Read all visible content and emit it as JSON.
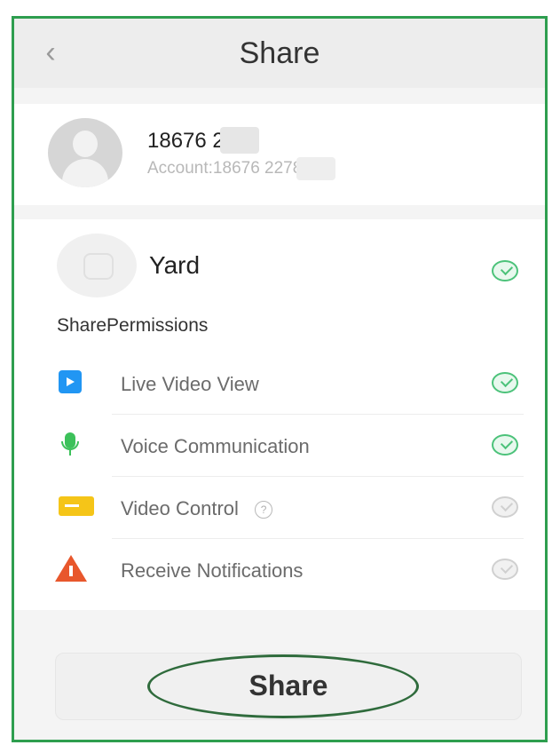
{
  "header": {
    "title": "Share",
    "back_icon": "chevron-left-icon"
  },
  "account": {
    "name": "18676 2278",
    "subtitle": "Account:18676 2278"
  },
  "device": {
    "name": "Yard",
    "selected": true
  },
  "permissions": {
    "heading": "SharePermissions",
    "items": [
      {
        "label": "Live Video View",
        "icon": "video-file-icon",
        "checked": true
      },
      {
        "label": "Voice Communication",
        "icon": "microphone-icon",
        "checked": true
      },
      {
        "label": "Video Control",
        "icon": "camera-icon",
        "checked": false,
        "help": "?"
      },
      {
        "label": "Receive Notifications",
        "icon": "warning-icon",
        "checked": false
      }
    ]
  },
  "share_button": {
    "label": "Share"
  },
  "colors": {
    "frame": "#2e9e4f",
    "check_on": "#4cc27a",
    "highlight_ellipse": "#2f6b3c"
  }
}
